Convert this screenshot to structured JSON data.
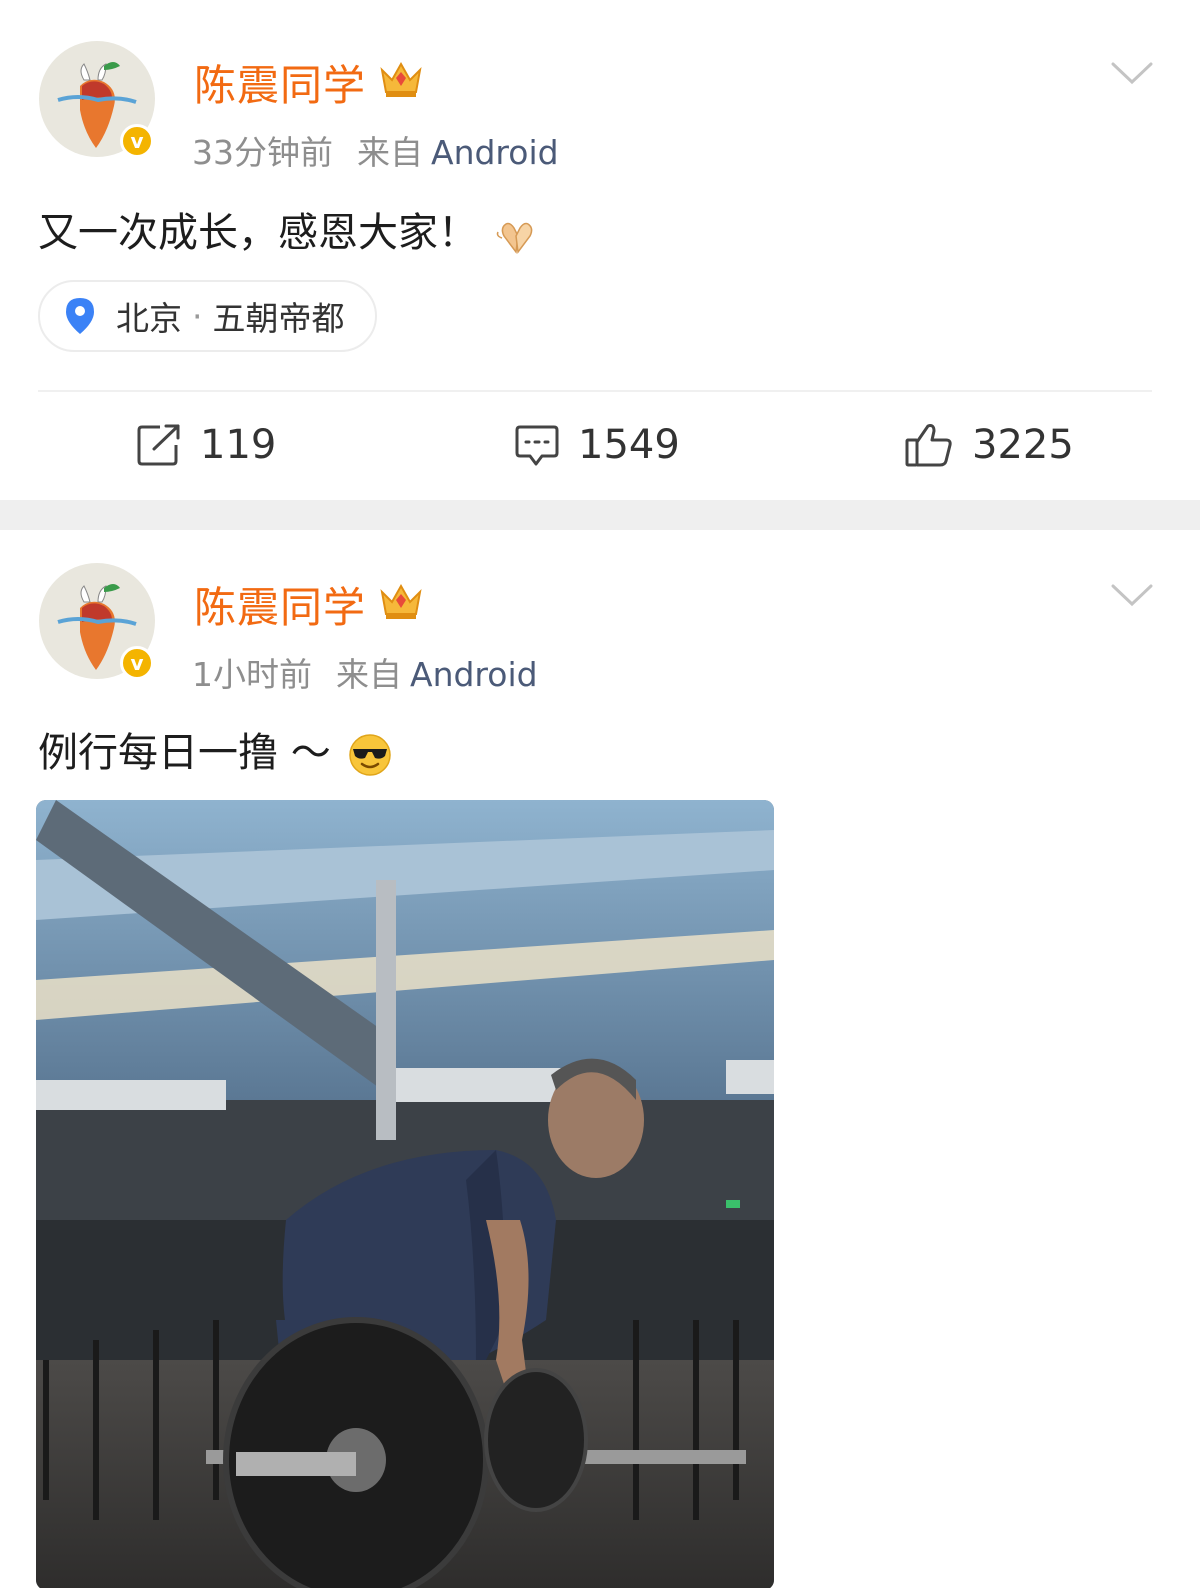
{
  "posts": [
    {
      "username": "陈震同学",
      "time": "33分钟前",
      "source_label": "来自",
      "device": "Android",
      "text": "又一次成长，感恩大家！",
      "location": {
        "city": "北京",
        "separator": "·",
        "name": "五朝帝都"
      },
      "actions": {
        "repost": "119",
        "comment": "1549",
        "like": "3225"
      }
    },
    {
      "username": "陈震同学",
      "time": "1小时前",
      "source_label": "来自",
      "device": "Android",
      "text": "例行每日一撸 ～"
    }
  ],
  "colors": {
    "username": "#f26a12",
    "device_link": "#4b5a78",
    "verified_badge": "#f4b400",
    "location_pin": "#3b82f6",
    "separator_band": "#efefef"
  },
  "icons": {
    "repost": "repost-icon",
    "comment": "comment-icon",
    "like": "thumbs-up-icon",
    "more": "chevron-down-icon",
    "location": "location-pin-icon",
    "member": "crown-icon",
    "verified": "verified-icon"
  }
}
